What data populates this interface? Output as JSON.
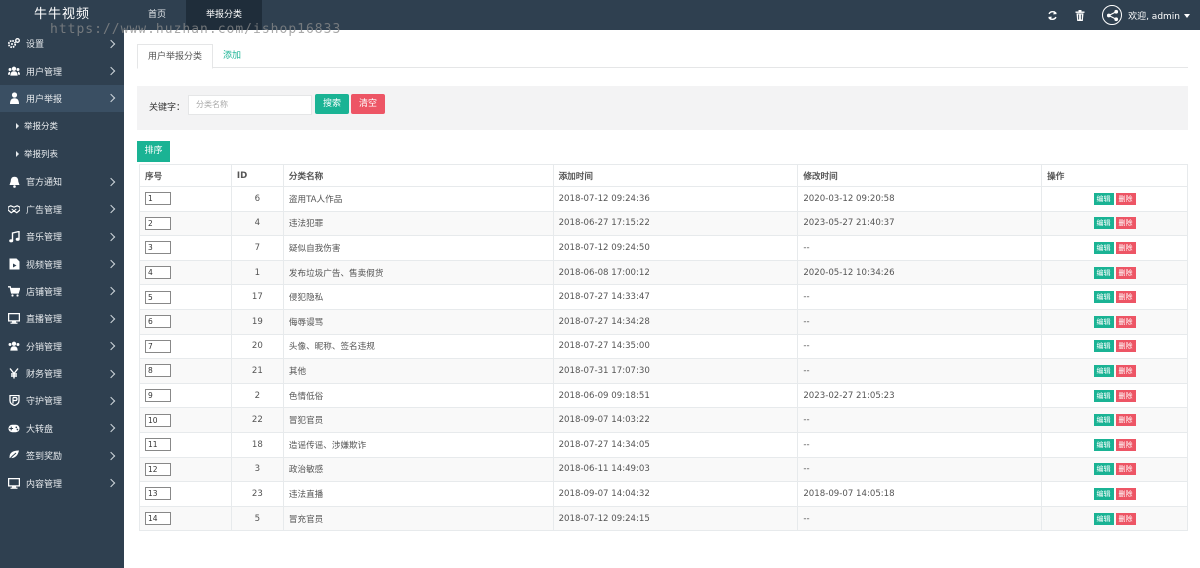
{
  "header": {
    "logo": "牛牛视频",
    "tabs": [
      {
        "label": "首页"
      },
      {
        "label": "举报分类"
      }
    ],
    "welcome": "欢迎, admin",
    "icons": [
      "refresh-icon",
      "trash-icon",
      "avatar-icon"
    ]
  },
  "watermark": "https://www.huzhan.com/ishop16833",
  "sidebar": {
    "items": [
      {
        "label": "设置",
        "icon": "gears-icon"
      },
      {
        "label": "用户管理",
        "icon": "users-icon"
      },
      {
        "label": "用户举报",
        "icon": "user-report-icon"
      },
      {
        "label": "官方通知",
        "icon": "bell-icon"
      },
      {
        "label": "广告管理",
        "icon": "handshake-icon"
      },
      {
        "label": "音乐管理",
        "icon": "music-icon"
      },
      {
        "label": "视频管理",
        "icon": "video-icon"
      },
      {
        "label": "店铺管理",
        "icon": "cart-icon"
      },
      {
        "label": "直播管理",
        "icon": "monitor-icon"
      },
      {
        "label": "分销管理",
        "icon": "users-icon"
      },
      {
        "label": "财务管理",
        "icon": "yen-icon"
      },
      {
        "label": "守护管理",
        "icon": "shield-icon"
      },
      {
        "label": "大转盘",
        "icon": "gamepad-icon"
      },
      {
        "label": "签到奖励",
        "icon": "leaf-icon"
      },
      {
        "label": "内容管理",
        "icon": "desktop-icon"
      }
    ],
    "subitems": [
      {
        "label": "举报分类"
      },
      {
        "label": "举报列表"
      }
    ]
  },
  "main": {
    "tabs": [
      {
        "label": "用户举报分类"
      },
      {
        "label": "添加"
      }
    ],
    "search": {
      "label": "关键字：",
      "placeholder": "分类名称",
      "search_button": "搜索",
      "clear_button": "清空"
    },
    "sort_button": "排序",
    "columns": [
      "序号",
      "ID",
      "分类名称",
      "添加时间",
      "修改时间",
      "操作"
    ],
    "edit_label": "编辑",
    "delete_label": "删除",
    "rows": [
      {
        "order": "1",
        "id": "6",
        "name": "盗用TA人作品",
        "added": "2018-07-12 09:24:36",
        "modified": "2020-03-12 09:20:58"
      },
      {
        "order": "2",
        "id": "4",
        "name": "违法犯罪",
        "added": "2018-06-27 17:15:22",
        "modified": "2023-05-27 21:40:37"
      },
      {
        "order": "3",
        "id": "7",
        "name": "疑似自我伤害",
        "added": "2018-07-12 09:24:50",
        "modified": "--"
      },
      {
        "order": "4",
        "id": "1",
        "name": "发布垃圾广告、售卖假货",
        "added": "2018-06-08 17:00:12",
        "modified": "2020-05-12 10:34:26"
      },
      {
        "order": "5",
        "id": "17",
        "name": "侵犯隐私",
        "added": "2018-07-27 14:33:47",
        "modified": "--"
      },
      {
        "order": "6",
        "id": "19",
        "name": "侮辱谩骂",
        "added": "2018-07-27 14:34:28",
        "modified": "--"
      },
      {
        "order": "7",
        "id": "20",
        "name": "头像、昵称、签名违规",
        "added": "2018-07-27 14:35:00",
        "modified": "--"
      },
      {
        "order": "8",
        "id": "21",
        "name": "其他",
        "added": "2018-07-31 17:07:30",
        "modified": "--"
      },
      {
        "order": "9",
        "id": "2",
        "name": "色情低俗",
        "added": "2018-06-09 09:18:51",
        "modified": "2023-02-27 21:05:23"
      },
      {
        "order": "10",
        "id": "22",
        "name": "冒犯官员",
        "added": "2018-09-07 14:03:22",
        "modified": "--"
      },
      {
        "order": "11",
        "id": "18",
        "name": "造谣传谣、涉嫌欺诈",
        "added": "2018-07-27 14:34:05",
        "modified": "--"
      },
      {
        "order": "12",
        "id": "3",
        "name": "政治敏感",
        "added": "2018-06-11 14:49:03",
        "modified": "--"
      },
      {
        "order": "13",
        "id": "23",
        "name": "违法直播",
        "added": "2018-09-07 14:04:32",
        "modified": "2018-09-07 14:05:18"
      },
      {
        "order": "14",
        "id": "5",
        "name": "冒充官员",
        "added": "2018-07-12 09:24:15",
        "modified": "--"
      }
    ]
  },
  "colors": {
    "sidebar": "#2f4050",
    "primary": "#1ab394",
    "danger": "#ed5565"
  }
}
